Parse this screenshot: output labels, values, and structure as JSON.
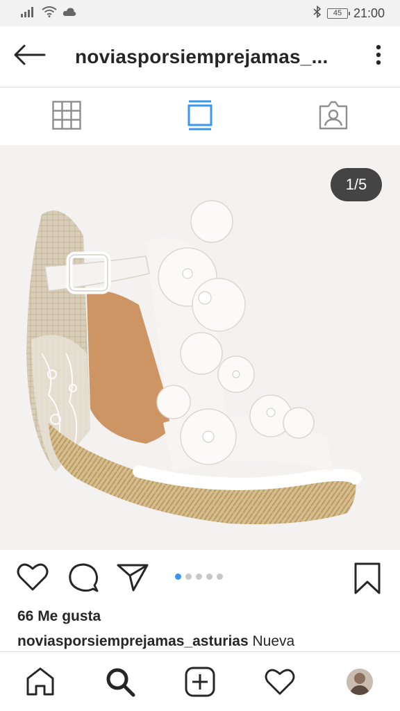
{
  "status_bar": {
    "time": "21:00",
    "battery": "45"
  },
  "header": {
    "title": "noviasporsiemprejamas_..."
  },
  "photo": {
    "counter": "1/5",
    "slide_count": 5,
    "active_slide": 1
  },
  "post": {
    "likes": "66 Me gusta",
    "caption_user": "noviasporsiemprejamas_asturias",
    "caption_text": " Nueva"
  },
  "colors": {
    "accent": "#3897f0",
    "text": "#262626",
    "divider": "#dbdbdb"
  },
  "icons": {
    "status_left": [
      "signal-icon",
      "wifi-icon",
      "cloud-icon"
    ],
    "status_right": [
      "bluetooth-icon",
      "battery-icon"
    ],
    "header": [
      "back-arrow-icon",
      "more-vertical-icon"
    ],
    "view_tabs": [
      "grid-icon",
      "feed-icon",
      "tagged-icon"
    ],
    "actions": [
      "heart-icon",
      "comment-icon",
      "share-icon",
      "bookmark-icon"
    ],
    "bottom_nav": [
      "home-icon",
      "search-icon",
      "add-icon",
      "activity-icon",
      "profile-avatar"
    ]
  }
}
